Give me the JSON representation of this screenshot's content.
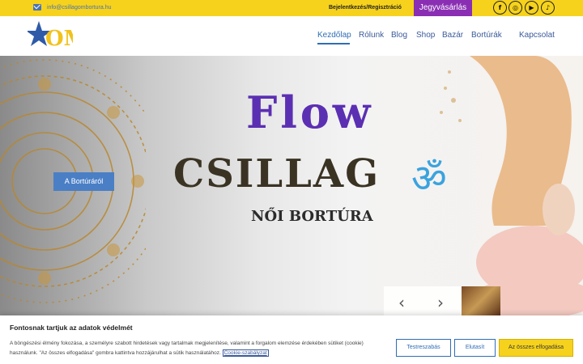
{
  "topbar": {
    "email": "info@csillagombortura.hu",
    "login": "Bejelentkezés/Regisztráció",
    "ticket": "Jegyvásárlás",
    "social": [
      "facebook-icon",
      "instagram-icon",
      "youtube-icon",
      "tiktok-icon"
    ],
    "social_glyphs": [
      "f",
      "◎",
      "▶",
      "♪"
    ]
  },
  "logo": {
    "text": "OM"
  },
  "nav": [
    "Kezdőlap",
    "Rólunk",
    "Blog",
    "Shop",
    "Bazár",
    "Bortúrák",
    "Kapcsolat"
  ],
  "hero": {
    "button": "A Bortúráról",
    "headline": "Flow",
    "brand": "CSILLAG",
    "om_symbol": "ॐ",
    "subtitle": "NŐI BORTÚRA",
    "prev": "‹",
    "next": "›"
  },
  "cookie": {
    "title": "Fontosnak tartjuk az adatok védelmét",
    "text": "A böngészési élmény fokozása, a személyre szabott hirdetések vagy tartalmak megjelenítése, valamint a forgalom elemzése érdekében sütiket (cookie) használunk. \"Az összes elfogadása\" gombra kattintva hozzájárulhat a sütik használatához.",
    "link": "Cookie-szabályzat",
    "customize": "Testreszabás",
    "reject": "Elutasít",
    "accept": "Az összes elfogadása"
  },
  "colors": {
    "accent": "#f6d21c",
    "ticket": "#8a2fb3",
    "primary": "#2f6db5"
  }
}
